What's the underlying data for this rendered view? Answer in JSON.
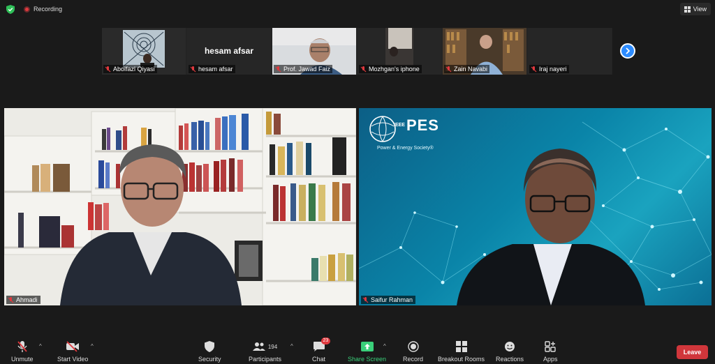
{
  "topbar": {
    "recording_label": "Recording",
    "view_label": "View"
  },
  "gallery": [
    {
      "name": "Abolfazl Qiyasi"
    },
    {
      "name": "hesam afsar",
      "display_name": "hesam afsar"
    },
    {
      "name": "Prof. Jawad Faiz"
    },
    {
      "name": "Mozhgan's iphone"
    },
    {
      "name": "Zain Navabi"
    },
    {
      "name": "Iraj nayeri"
    }
  ],
  "main": {
    "left_name": "Ahmadi",
    "right_name": "Saifur Rahman",
    "logo_top": "IEEE",
    "logo_main": "PES",
    "logo_sub": "Power & Energy Society®"
  },
  "toolbar": {
    "unmute": "Unmute",
    "start_video": "Start Video",
    "security": "Security",
    "participants": "Participants",
    "participants_count": "194",
    "chat": "Chat",
    "chat_badge": "23",
    "share_screen": "Share Screen",
    "record": "Record",
    "breakout_rooms": "Breakout Rooms",
    "reactions": "Reactions",
    "apps": "Apps",
    "leave": "Leave"
  },
  "colors": {
    "accent": "#2d8cff",
    "recording": "#e0393e",
    "share": "#3ad07a",
    "leave": "#d0363b"
  }
}
